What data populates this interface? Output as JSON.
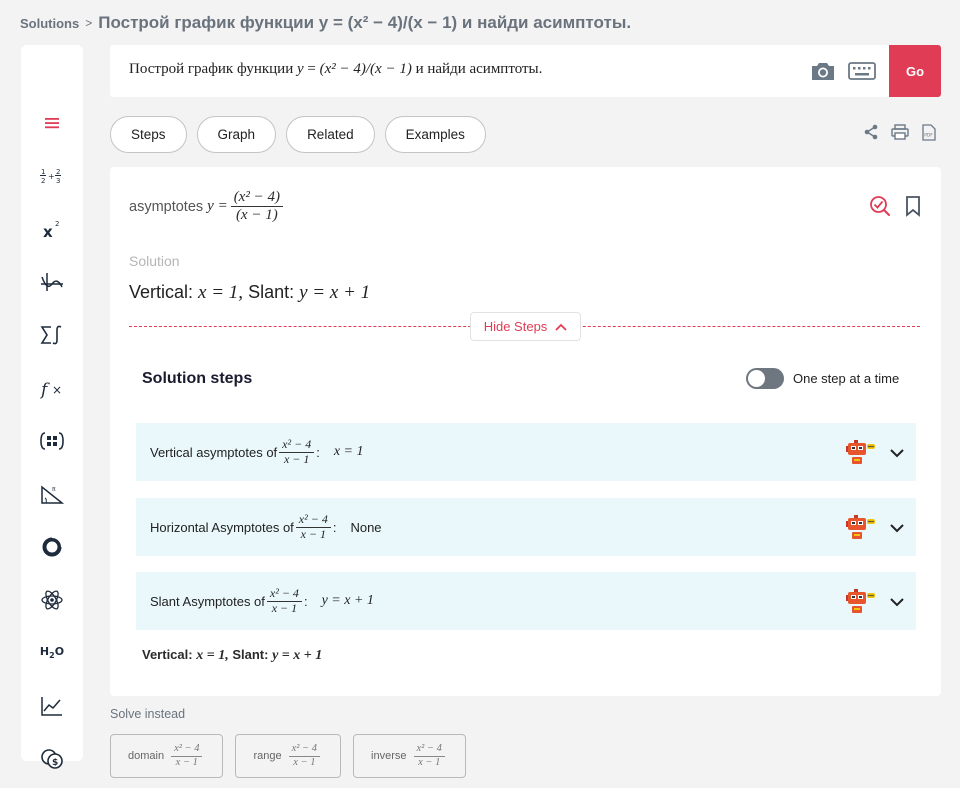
{
  "breadcrumb": {
    "root": "Solutions",
    "separator": ">",
    "title": "Построй график функции y = (x² − 4)/(x − 1) и найди асимптоты."
  },
  "sidebar": {
    "items": [
      {
        "icon": "hamburger-menu-icon"
      },
      {
        "icon": "fractions-icon"
      },
      {
        "icon": "exponent-icon"
      },
      {
        "icon": "calculus-graph-icon"
      },
      {
        "icon": "sum-integral-icon"
      },
      {
        "icon": "function-icon"
      },
      {
        "icon": "matrix-icon"
      },
      {
        "icon": "trigonometry-icon"
      },
      {
        "icon": "statistics-donut-icon"
      },
      {
        "icon": "atom-icon"
      },
      {
        "icon": "chemistry-h2o-icon"
      },
      {
        "icon": "line-chart-icon"
      },
      {
        "icon": "finance-coins-icon"
      }
    ],
    "chemistry_label": "H",
    "chemistry_sub": "2",
    "chemistry_o": "O"
  },
  "query": {
    "prefix": "Построй график функции",
    "var": "y",
    "eq": " = ",
    "expr": "(x² − 4)/(x − 1)",
    "suffix": "и найди асимптоты.",
    "go_label": "Go",
    "camera_icon": "camera-icon",
    "keyboard_icon": "keyboard-icon"
  },
  "tabs": [
    "Steps",
    "Graph",
    "Related",
    "Examples"
  ],
  "tools": [
    "share-icon",
    "print-icon",
    "pdf-icon"
  ],
  "problem": {
    "word": "asymptotes",
    "lhs": "y =",
    "num": "(x² − 4)",
    "den": "(x − 1)"
  },
  "solution": {
    "label": "Solution",
    "vertical_word": "Vertical:",
    "vertical_math": "x = 1,",
    "slant_word": "Slant:",
    "slant_math": "y = x + 1"
  },
  "hide_steps_label": "Hide Steps",
  "steps_title": "Solution steps",
  "toggle_label": "One step at a time",
  "toggle_on": false,
  "steps": [
    {
      "label": "Vertical asymptotes of",
      "num": "x² − 4",
      "den": "x − 1",
      "colon": ":",
      "result": "x = 1"
    },
    {
      "label": "Horizontal Asymptotes of",
      "num": "x² − 4",
      "den": "x − 1",
      "colon": ":",
      "result": "None"
    },
    {
      "label": "Slant Asymptotes of",
      "num": "x² − 4",
      "den": "x − 1",
      "colon": ":",
      "result": "y = x + 1"
    }
  ],
  "final": {
    "vertical_word": "Vertical:",
    "vertical_math": "x = 1,",
    "slant_word": "Slant:",
    "slant_math": "y = x + 1"
  },
  "solve_instead": {
    "label": "Solve instead",
    "chips": [
      {
        "label": "domain",
        "num": "x² − 4",
        "den": "x − 1"
      },
      {
        "label": "range",
        "num": "x² − 4",
        "den": "x − 1"
      },
      {
        "label": "inverse",
        "num": "x² − 4",
        "den": "x − 1"
      }
    ]
  },
  "colors": {
    "accent": "#e03c55",
    "step_bg": "#eaf8fc",
    "sidebar_icon": "#1e2b3c"
  }
}
